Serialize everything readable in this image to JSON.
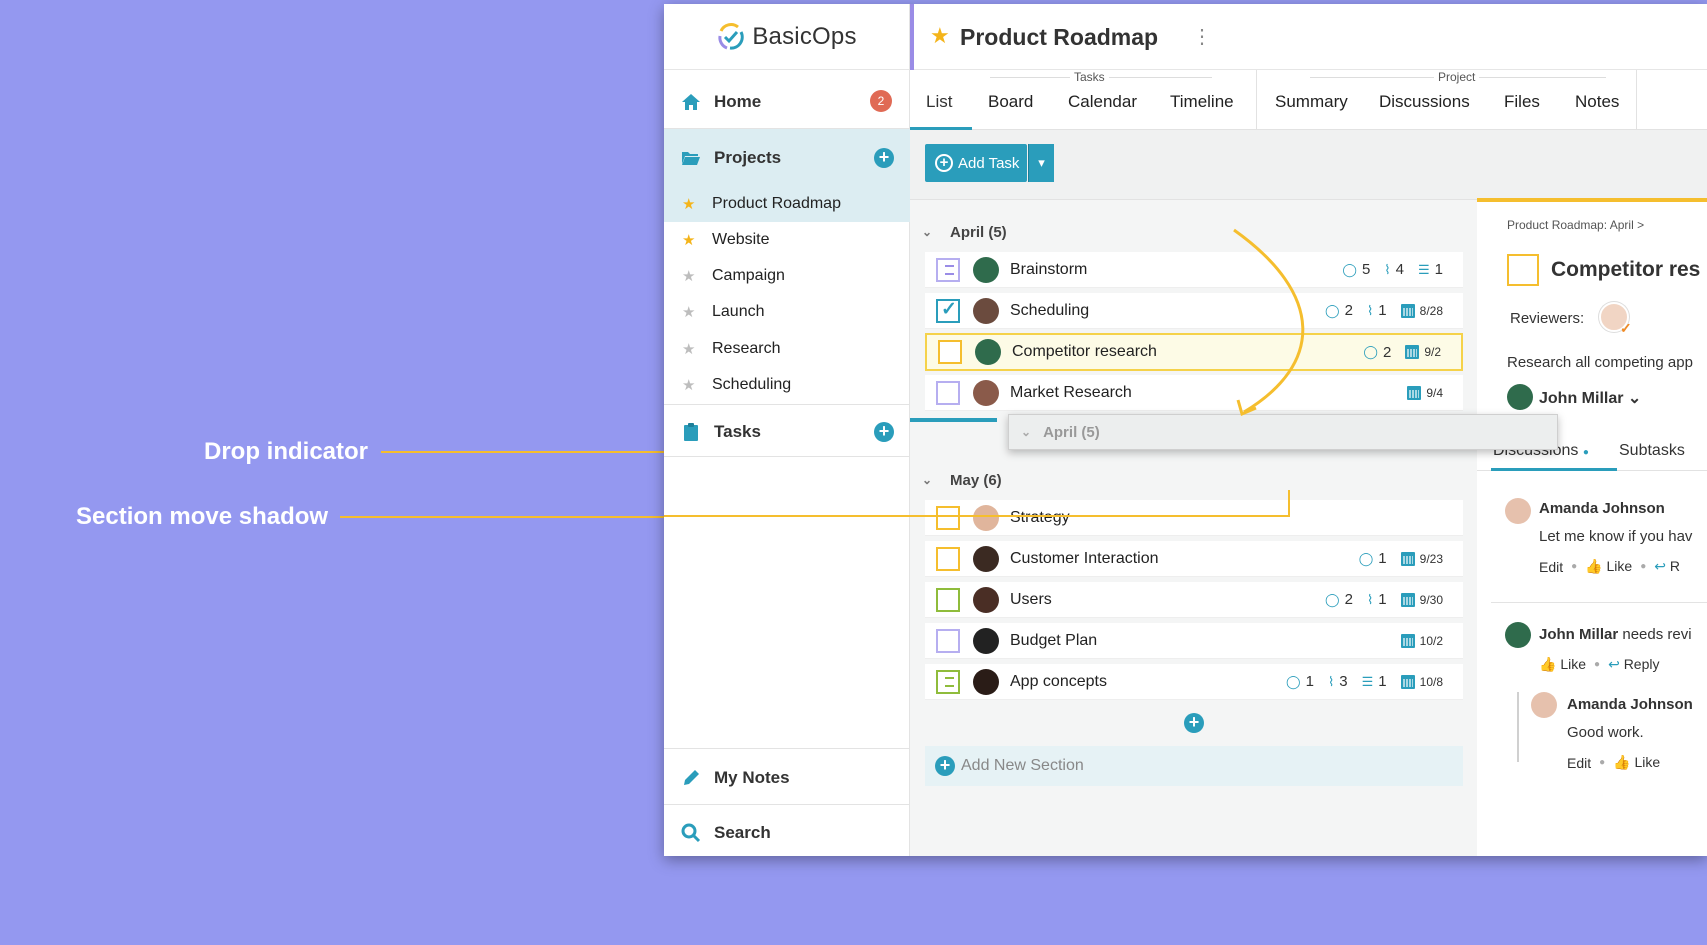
{
  "callouts": {
    "drop_indicator": "Drop indicator",
    "section_move_shadow": "Section move shadow"
  },
  "brand": {
    "logo_text": "BasicOps"
  },
  "sidebar": {
    "home": {
      "label": "Home",
      "badge": "2"
    },
    "projects": {
      "label": "Projects"
    },
    "project_items": [
      {
        "label": "Product Roadmap",
        "starred": true
      },
      {
        "label": "Website",
        "starred": true
      },
      {
        "label": "Campaign",
        "starred": false
      },
      {
        "label": "Launch",
        "starred": false
      },
      {
        "label": "Research",
        "starred": false
      },
      {
        "label": "Scheduling",
        "starred": false
      }
    ],
    "tasks": {
      "label": "Tasks"
    },
    "my_notes": {
      "label": "My Notes"
    },
    "search": {
      "label": "Search"
    }
  },
  "header": {
    "title": "Product Roadmap",
    "menu_glyph": "⋮"
  },
  "tabs": {
    "tasks_group": "Tasks",
    "project_group": "Project",
    "items": [
      "List",
      "Board",
      "Calendar",
      "Timeline",
      "Summary",
      "Discussions",
      "Files",
      "Notes"
    ],
    "active": "List"
  },
  "toolbar": {
    "add_task": "Add Task"
  },
  "sections": [
    {
      "header": "April (5)",
      "tasks": [
        {
          "name": "Brainstorm",
          "comments": "5",
          "attachments": "4",
          "subtasks": "1",
          "date": ""
        },
        {
          "name": "Scheduling",
          "comments": "2",
          "attachments": "1",
          "subtasks": "",
          "date": "8/28"
        },
        {
          "name": "Competitor research",
          "comments": "2",
          "attachments": "",
          "subtasks": "",
          "date": "9/2"
        },
        {
          "name": "Market Research",
          "comments": "",
          "attachments": "",
          "subtasks": "",
          "date": "9/4"
        }
      ]
    },
    {
      "header": "May (6)",
      "tasks": [
        {
          "name": "Strategy",
          "comments": "",
          "attachments": "",
          "subtasks": "",
          "date": ""
        },
        {
          "name": "Customer Interaction",
          "comments": "1",
          "attachments": "",
          "subtasks": "",
          "date": "9/23"
        },
        {
          "name": "Users",
          "comments": "2",
          "attachments": "1",
          "subtasks": "",
          "date": "9/30"
        },
        {
          "name": "Budget Plan",
          "comments": "",
          "attachments": "",
          "subtasks": "",
          "date": "10/2"
        },
        {
          "name": "App concepts",
          "comments": "1",
          "attachments": "3",
          "subtasks": "1",
          "date": "10/8"
        }
      ]
    }
  ],
  "drag_shadow": {
    "header": "April (5)"
  },
  "add_new_section": "Add New Section",
  "detail": {
    "breadcrumb": "Product Roadmap: April  >",
    "title": "Competitor res",
    "reviewers_label": "Reviewers:",
    "description": "Research all competing app",
    "owner": "John Millar",
    "tab_discussions": "Discussions",
    "tab_subtasks": "Subtasks",
    "comments": [
      {
        "author": "Amanda Johnson",
        "text": "Let me know if you hav",
        "actions": [
          "Edit",
          "Like",
          "R"
        ]
      },
      {
        "author": "John Millar",
        "text": " needs revi",
        "actions": [
          "Like",
          "Reply"
        ]
      },
      {
        "author": "Amanda Johnson",
        "text": "Good work.",
        "actions": [
          "Edit",
          "Like"
        ]
      }
    ]
  },
  "colors": {
    "accent": "#2a9dbb",
    "highlight": "#f5be2e",
    "background": "#9498f0"
  }
}
